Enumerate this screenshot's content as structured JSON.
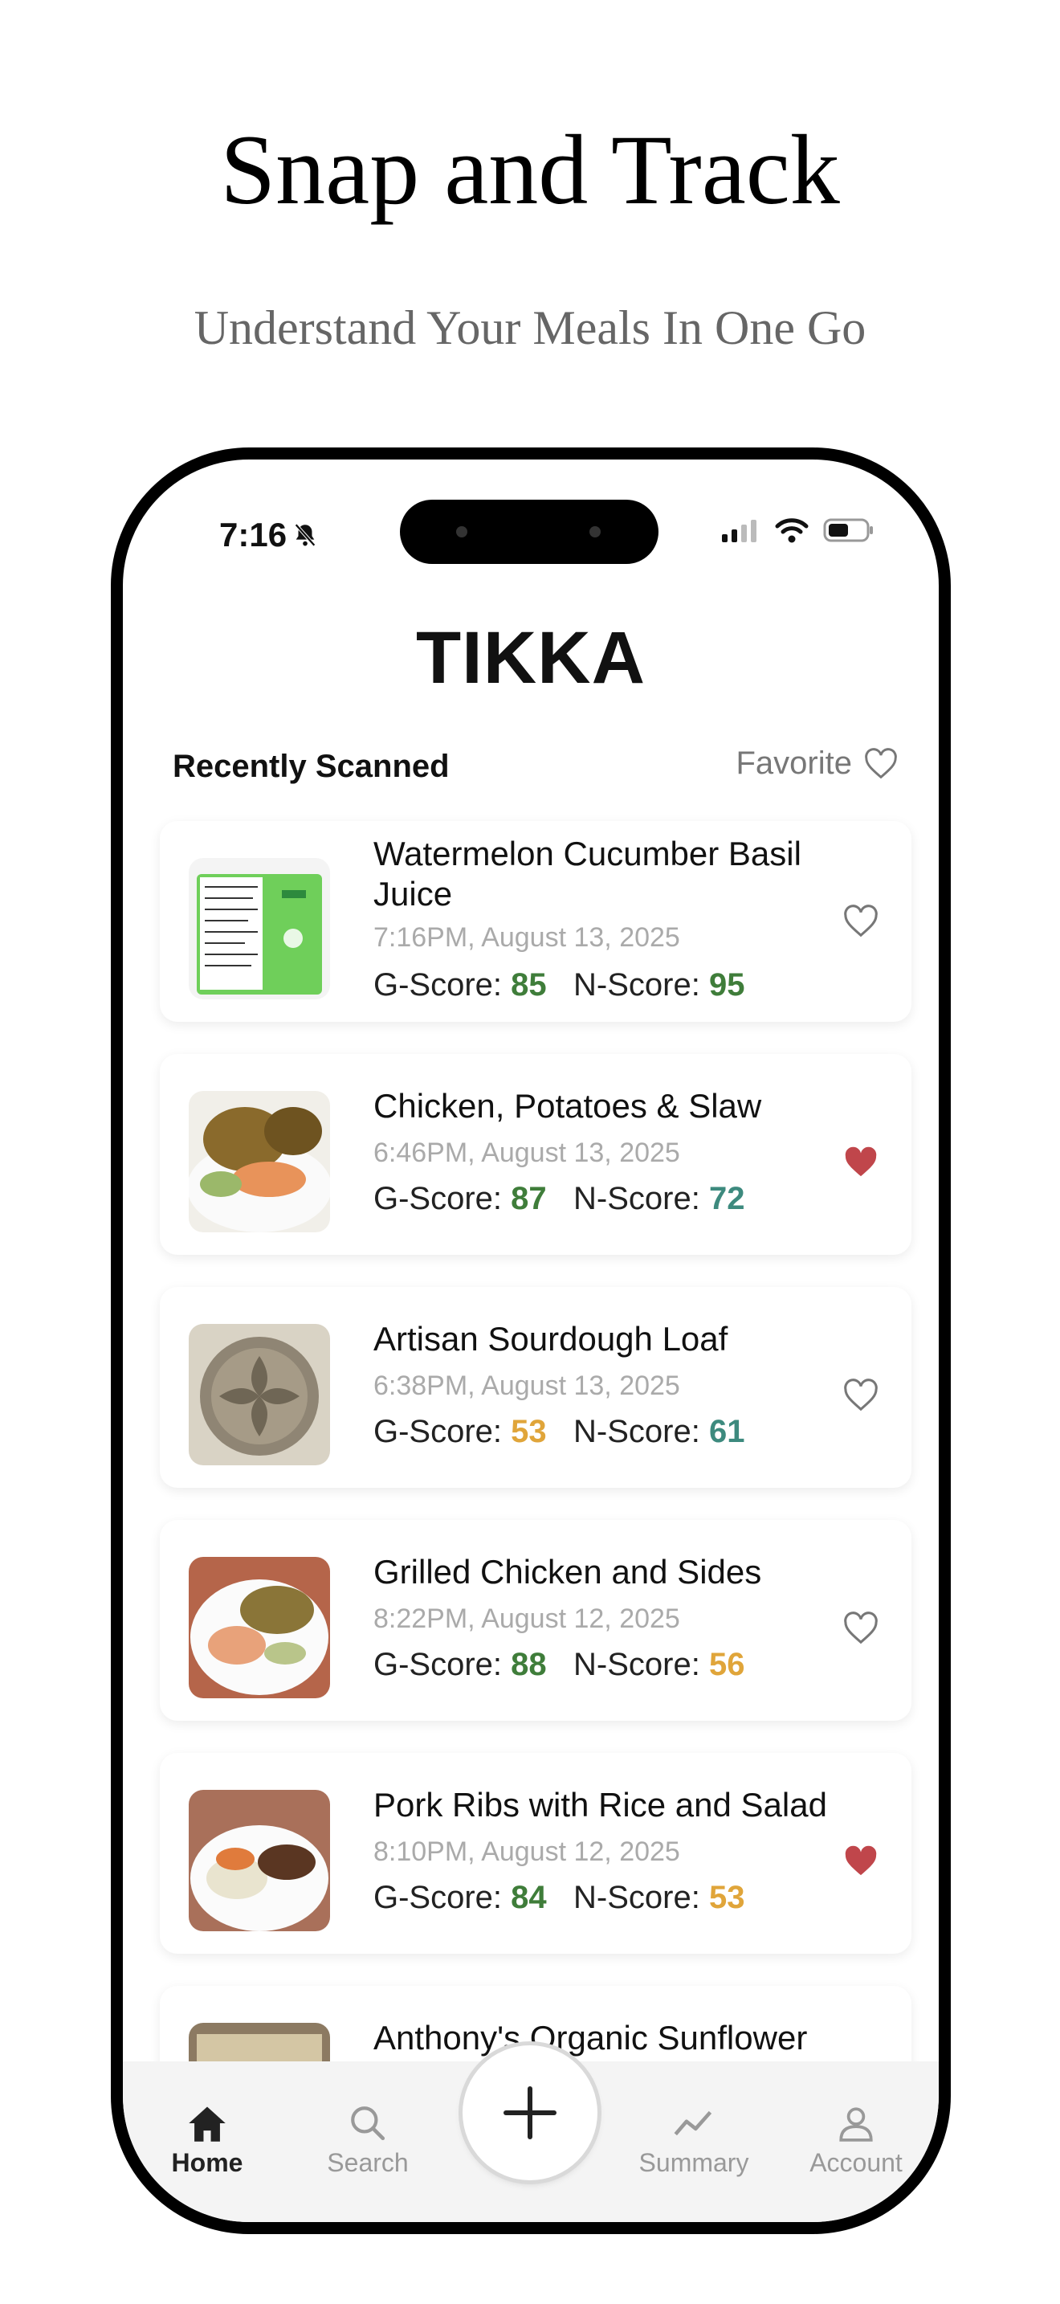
{
  "hero": {
    "title": "Snap and Track",
    "subtitle": "Understand Your Meals In One Go"
  },
  "status_bar": {
    "time": "7:16",
    "icons": [
      "bell-slash-icon",
      "signal-icon",
      "wifi-icon",
      "battery-icon"
    ]
  },
  "app": {
    "title": "TIKKA",
    "section_label": "Recently Scanned",
    "favorite_label": "Favorite"
  },
  "colors": {
    "score_green": "#3f7d3a",
    "score_teal": "#3d8a7e",
    "score_yellow": "#e0a53a",
    "heart_filled": "#c0464b"
  },
  "items": [
    {
      "name": "Watermelon Cucumber Basil Juice",
      "time": "7:16PM, August 13, 2025",
      "g_label": "G-Score:",
      "g": "85",
      "n_label": "N-Score:",
      "n": "95",
      "favorite": false
    },
    {
      "name": "Chicken, Potatoes & Slaw",
      "time": "6:46PM, August 13, 2025",
      "g_label": "G-Score:",
      "g": "87",
      "n_label": "N-Score:",
      "n": "72",
      "favorite": true
    },
    {
      "name": "Artisan Sourdough Loaf",
      "time": "6:38PM, August 13, 2025",
      "g_label": "G-Score:",
      "g": "53",
      "n_label": "N-Score:",
      "n": "61",
      "favorite": false
    },
    {
      "name": "Grilled Chicken and Sides",
      "time": "8:22PM, August 12, 2025",
      "g_label": "G-Score:",
      "g": "88",
      "n_label": "N-Score:",
      "n": "56",
      "favorite": false
    },
    {
      "name": "Pork Ribs with Rice and Salad",
      "time": "8:10PM, August 12, 2025",
      "g_label": "G-Score:",
      "g": "84",
      "n_label": "N-Score:",
      "n": "53",
      "favorite": true
    },
    {
      "name": "Anthony's Organic Sunflower Seeds"
    }
  ],
  "tabbar": {
    "home": "Home",
    "search": "Search",
    "summary": "Summary",
    "account": "Account"
  }
}
